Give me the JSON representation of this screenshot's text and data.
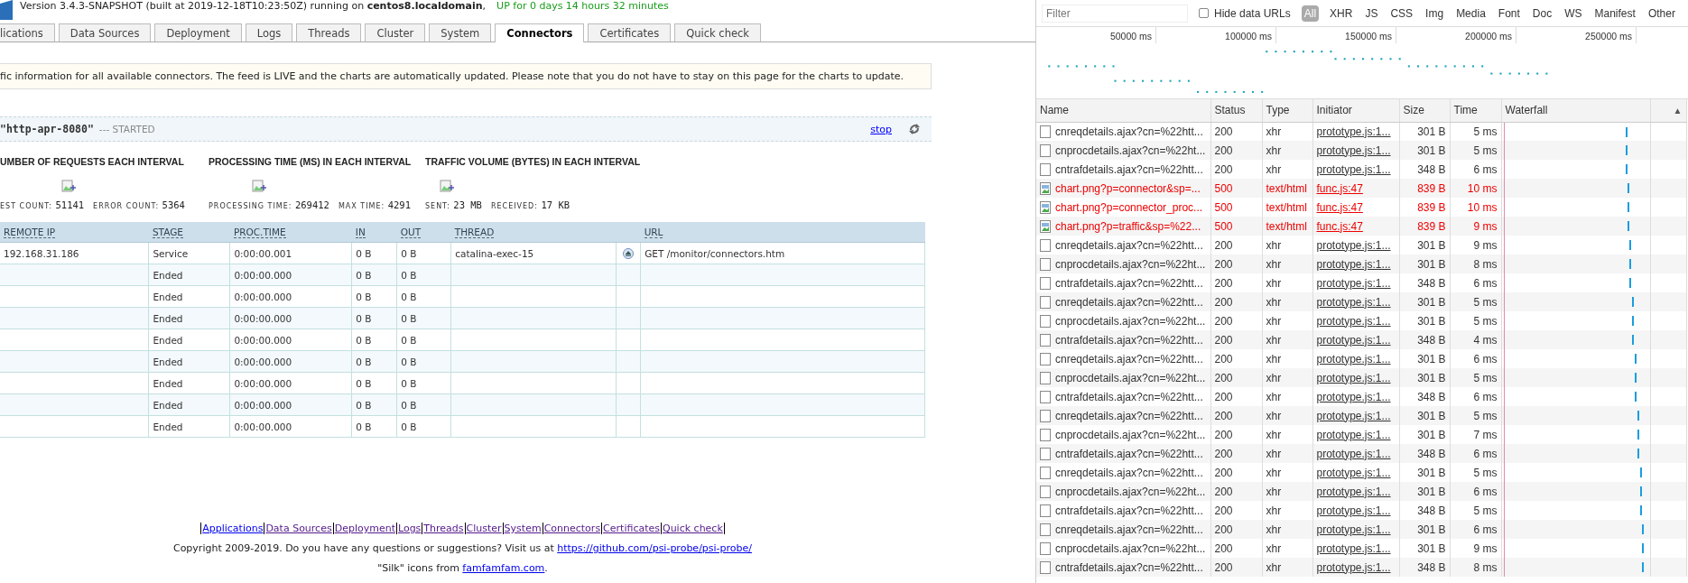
{
  "header": {
    "version_text": "Version 3.4.3-SNAPSHOT (built at 2019-12-18T10:23:50Z) running on **centos8.localdomain**,",
    "uptime": "UP for 0 days 14 hours 32 minutes"
  },
  "tabs": [
    {
      "label": "lications",
      "selected": false
    },
    {
      "label": "Data Sources",
      "selected": false
    },
    {
      "label": "Deployment",
      "selected": false
    },
    {
      "label": "Logs",
      "selected": false
    },
    {
      "label": "Threads",
      "selected": false
    },
    {
      "label": "Cluster",
      "selected": false
    },
    {
      "label": "System",
      "selected": false
    },
    {
      "label": "Connectors",
      "selected": true
    },
    {
      "label": "Certificates",
      "selected": false
    },
    {
      "label": "Quick check",
      "selected": false
    }
  ],
  "notice": "fic information for all available connectors. The feed is LIVE and the charts are automatically updated. Please note that you do not have to stay on this page for the charts to update.",
  "connector": {
    "name": "\"http-apr-8080\"",
    "status": "--- STARTED",
    "stop": "stop"
  },
  "charts": [
    {
      "title": "UMBER OF REQUESTS EACH INTERVAL",
      "stats": [
        {
          "label": "EST COUNT:",
          "value": "51141"
        },
        {
          "label": "ERROR COUNT:",
          "value": "5364"
        }
      ]
    },
    {
      "title": "PROCESSING TIME (MS) IN EACH INTERVAL",
      "stats": [
        {
          "label": "PROCESSING TIME:",
          "value": "269412"
        },
        {
          "label": "MAX TIME:",
          "value": "4291"
        }
      ]
    },
    {
      "title": "TRAFFIC VOLUME (BYTES) IN EACH INTERVAL",
      "stats": [
        {
          "label": "SENT:",
          "value": "23 MB"
        },
        {
          "label": "RECEIVED:",
          "value": "17 KB"
        }
      ]
    }
  ],
  "requests_table": {
    "columns": [
      "REMOTE IP",
      "STAGE",
      "PROC.TIME",
      "IN",
      "OUT",
      "THREAD",
      "URL"
    ],
    "rows": [
      {
        "kind": "active",
        "remote_ip": "192.168.31.186",
        "stage": "Service",
        "proc_time": "0:00:00.001",
        "in": "0 B",
        "out": "0 B",
        "thread": "catalina-exec-15",
        "url": "GET /monitor/connectors.htm"
      },
      {
        "kind": "ended",
        "stage": "Ended",
        "proc_time": "0:00:00.000",
        "in": "0 B",
        "out": "0 B"
      },
      {
        "kind": "ended",
        "stage": "Ended",
        "proc_time": "0:00:00.000",
        "in": "0 B",
        "out": "0 B"
      },
      {
        "kind": "ended",
        "stage": "Ended",
        "proc_time": "0:00:00.000",
        "in": "0 B",
        "out": "0 B"
      },
      {
        "kind": "ended",
        "stage": "Ended",
        "proc_time": "0:00:00.000",
        "in": "0 B",
        "out": "0 B"
      },
      {
        "kind": "ended",
        "stage": "Ended",
        "proc_time": "0:00:00.000",
        "in": "0 B",
        "out": "0 B"
      },
      {
        "kind": "ended",
        "stage": "Ended",
        "proc_time": "0:00:00.000",
        "in": "0 B",
        "out": "0 B"
      },
      {
        "kind": "ended",
        "stage": "Ended",
        "proc_time": "0:00:00.000",
        "in": "0 B",
        "out": "0 B"
      },
      {
        "kind": "ended",
        "stage": "Ended",
        "proc_time": "0:00:00.000",
        "in": "0 B",
        "out": "0 B"
      }
    ]
  },
  "footer": {
    "links": [
      {
        "label": "Applications",
        "visited": false
      },
      {
        "label": "Data Sources",
        "visited": true
      },
      {
        "label": "Deployment",
        "visited": true
      },
      {
        "label": "Logs",
        "visited": true
      },
      {
        "label": "Threads",
        "visited": true
      },
      {
        "label": "Cluster",
        "visited": true
      },
      {
        "label": "System",
        "visited": true
      },
      {
        "label": "Connectors",
        "visited": true
      },
      {
        "label": "Certificates",
        "visited": true
      },
      {
        "label": "Quick check",
        "visited": true
      }
    ],
    "copyright": "Copyright 2009-2019. Do you have any questions or suggestions? Visit us at",
    "repo_link": "https://github.com/psi-probe/psi-probe/",
    "credit": "\"Silk\" icons from",
    "credit_link": "famfamfam.com",
    "credit_end": "."
  },
  "devtools": {
    "filter": {
      "placeholder": "Filter"
    },
    "hide_data_urls": {
      "label": "Hide data URLs",
      "checked": false
    },
    "type_filters": [
      {
        "label": "All",
        "selected": true
      },
      {
        "label": "XHR",
        "selected": false
      },
      {
        "label": "JS",
        "selected": false
      },
      {
        "label": "CSS",
        "selected": false
      },
      {
        "label": "Img",
        "selected": false
      },
      {
        "label": "Media",
        "selected": false
      },
      {
        "label": "Font",
        "selected": false
      },
      {
        "label": "Doc",
        "selected": false
      },
      {
        "label": "WS",
        "selected": false
      },
      {
        "label": "Manifest",
        "selected": false
      },
      {
        "label": "Other",
        "selected": false
      }
    ],
    "overview": {
      "ticks": [
        "50000 ms",
        "100000 ms",
        "150000 ms",
        "200000 ms",
        "250000 ms"
      ]
    },
    "columns": [
      "Name",
      "Status",
      "Type",
      "Initiator",
      "Size",
      "Time",
      "Waterfall"
    ],
    "sort_indicator": "▲",
    "rows": [
      {
        "kind": "xhr",
        "failed": false,
        "name": "cnreqdetails.ajax?cn=%22htt...",
        "status": "200",
        "type": "xhr",
        "initiator": "prototype.js:1...",
        "size": "301 B",
        "time": "5 ms",
        "level": 0.84
      },
      {
        "kind": "xhr",
        "failed": false,
        "name": "cnprocdetails.ajax?cn=%22ht...",
        "status": "200",
        "type": "xhr",
        "initiator": "prototype.js:1...",
        "size": "301 B",
        "time": "5 ms",
        "level": 0.84
      },
      {
        "kind": "xhr",
        "failed": false,
        "name": "cntrafdetails.ajax?cn=%22htt...",
        "status": "200",
        "type": "xhr",
        "initiator": "prototype.js:1...",
        "size": "348 B",
        "time": "6 ms",
        "level": 0.84
      },
      {
        "kind": "image",
        "failed": true,
        "name": "chart.png?p=connector&sp=...",
        "status": "500",
        "type": "text/html",
        "initiator": "func.js:47",
        "size": "839 B",
        "time": "10 ms",
        "level": 0.85
      },
      {
        "kind": "image",
        "failed": true,
        "name": "chart.png?p=connector_proc...",
        "status": "500",
        "type": "text/html",
        "initiator": "func.js:47",
        "size": "839 B",
        "time": "10 ms",
        "level": 0.85
      },
      {
        "kind": "image",
        "failed": true,
        "name": "chart.png?p=traffic&sp=%22...",
        "status": "500",
        "type": "text/html",
        "initiator": "func.js:47",
        "size": "839 B",
        "time": "9 ms",
        "level": 0.85
      },
      {
        "kind": "xhr",
        "failed": false,
        "name": "cnreqdetails.ajax?cn=%22htt...",
        "status": "200",
        "type": "xhr",
        "initiator": "prototype.js:1...",
        "size": "301 B",
        "time": "9 ms",
        "level": 0.86
      },
      {
        "kind": "xhr",
        "failed": false,
        "name": "cnprocdetails.ajax?cn=%22ht...",
        "status": "200",
        "type": "xhr",
        "initiator": "prototype.js:1...",
        "size": "301 B",
        "time": "8 ms",
        "level": 0.86
      },
      {
        "kind": "xhr",
        "failed": false,
        "name": "cntrafdetails.ajax?cn=%22htt...",
        "status": "200",
        "type": "xhr",
        "initiator": "prototype.js:1...",
        "size": "348 B",
        "time": "6 ms",
        "level": 0.86
      },
      {
        "kind": "xhr",
        "failed": false,
        "name": "cnreqdetails.ajax?cn=%22htt...",
        "status": "200",
        "type": "xhr",
        "initiator": "prototype.js:1...",
        "size": "301 B",
        "time": "5 ms",
        "level": 0.88
      },
      {
        "kind": "xhr",
        "failed": false,
        "name": "cnprocdetails.ajax?cn=%22ht...",
        "status": "200",
        "type": "xhr",
        "initiator": "prototype.js:1...",
        "size": "301 B",
        "time": "5 ms",
        "level": 0.88
      },
      {
        "kind": "xhr",
        "failed": false,
        "name": "cntrafdetails.ajax?cn=%22htt...",
        "status": "200",
        "type": "xhr",
        "initiator": "prototype.js:1...",
        "size": "348 B",
        "time": "4 ms",
        "level": 0.88
      },
      {
        "kind": "xhr",
        "failed": false,
        "name": "cnreqdetails.ajax?cn=%22htt...",
        "status": "200",
        "type": "xhr",
        "initiator": "prototype.js:1...",
        "size": "301 B",
        "time": "6 ms",
        "level": 0.9
      },
      {
        "kind": "xhr",
        "failed": false,
        "name": "cnprocdetails.ajax?cn=%22ht...",
        "status": "200",
        "type": "xhr",
        "initiator": "prototype.js:1...",
        "size": "301 B",
        "time": "5 ms",
        "level": 0.9
      },
      {
        "kind": "xhr",
        "failed": false,
        "name": "cntrafdetails.ajax?cn=%22htt...",
        "status": "200",
        "type": "xhr",
        "initiator": "prototype.js:1...",
        "size": "348 B",
        "time": "6 ms",
        "level": 0.9
      },
      {
        "kind": "xhr",
        "failed": false,
        "name": "cnreqdetails.ajax?cn=%22htt...",
        "status": "200",
        "type": "xhr",
        "initiator": "prototype.js:1...",
        "size": "301 B",
        "time": "5 ms",
        "level": 0.92
      },
      {
        "kind": "xhr",
        "failed": false,
        "name": "cnprocdetails.ajax?cn=%22ht...",
        "status": "200",
        "type": "xhr",
        "initiator": "prototype.js:1...",
        "size": "301 B",
        "time": "7 ms",
        "level": 0.92
      },
      {
        "kind": "xhr",
        "failed": false,
        "name": "cntrafdetails.ajax?cn=%22htt...",
        "status": "200",
        "type": "xhr",
        "initiator": "prototype.js:1...",
        "size": "348 B",
        "time": "6 ms",
        "level": 0.92
      },
      {
        "kind": "xhr",
        "failed": false,
        "name": "cnreqdetails.ajax?cn=%22htt...",
        "status": "200",
        "type": "xhr",
        "initiator": "prototype.js:1...",
        "size": "301 B",
        "time": "5 ms",
        "level": 0.935
      },
      {
        "kind": "xhr",
        "failed": false,
        "name": "cnprocdetails.ajax?cn=%22ht...",
        "status": "200",
        "type": "xhr",
        "initiator": "prototype.js:1...",
        "size": "301 B",
        "time": "6 ms",
        "level": 0.935
      },
      {
        "kind": "xhr",
        "failed": false,
        "name": "cntrafdetails.ajax?cn=%22htt...",
        "status": "200",
        "type": "xhr",
        "initiator": "prototype.js:1...",
        "size": "348 B",
        "time": "5 ms",
        "level": 0.935
      },
      {
        "kind": "xhr",
        "failed": false,
        "name": "cnreqdetails.ajax?cn=%22htt...",
        "status": "200",
        "type": "xhr",
        "initiator": "prototype.js:1...",
        "size": "301 B",
        "time": "6 ms",
        "level": 0.95
      },
      {
        "kind": "xhr",
        "failed": false,
        "name": "cnprocdetails.ajax?cn=%22ht...",
        "status": "200",
        "type": "xhr",
        "initiator": "prototype.js:1...",
        "size": "301 B",
        "time": "9 ms",
        "level": 0.95
      },
      {
        "kind": "xhr",
        "failed": false,
        "name": "cntrafdetails.ajax?cn=%22htt...",
        "status": "200",
        "type": "xhr",
        "initiator": "prototype.js:1...",
        "size": "348 B",
        "time": "8 ms",
        "level": 0.95
      }
    ]
  }
}
